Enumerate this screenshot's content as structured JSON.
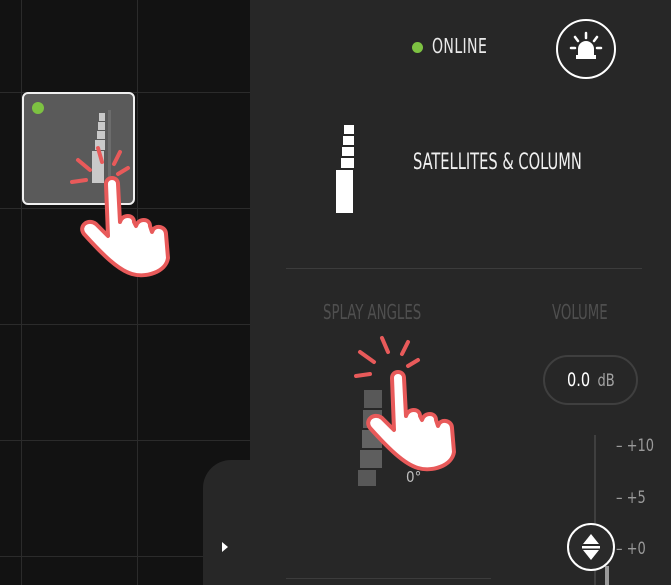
{
  "device": {
    "status": "ONLINE",
    "status_color": "#7dc242",
    "name": "SATELLITES & COLUMN",
    "tile_icon": "column-speaker-icon",
    "identify_icon": "identify-beacon-icon"
  },
  "sections": {
    "splay_label": "SPLAY ANGLES",
    "volume_label": "VOLUME"
  },
  "splay": {
    "value": "0°"
  },
  "volume": {
    "value": "0.0",
    "unit": "dB",
    "ticks": [
      "– +10",
      "– +5",
      "– +0"
    ]
  },
  "panel_toggle_icon": "chevron-right-icon",
  "tap_gesture_icon": "tap-hand-icon"
}
